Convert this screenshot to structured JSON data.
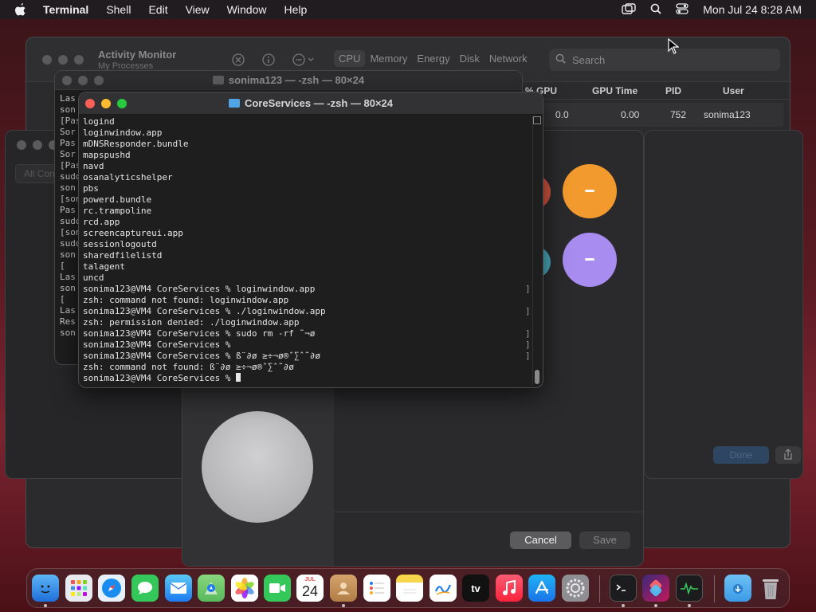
{
  "menubar": {
    "app": "Terminal",
    "items": [
      "Shell",
      "Edit",
      "View",
      "Window",
      "Help"
    ],
    "clock": "Mon Jul 24  8:28 AM"
  },
  "activity_monitor": {
    "title": "Activity Monitor",
    "subtitle": "My Processes",
    "tabs": [
      "CPU",
      "Memory",
      "Energy",
      "Disk",
      "Network"
    ],
    "search_placeholder": "Search",
    "columns": [
      "% GPU",
      "GPU Time",
      "PID",
      "User"
    ],
    "row": {
      "gpu": "0.0",
      "gpu_time": "0.00",
      "pid": "752",
      "user": "sonima123"
    }
  },
  "back_window": {
    "field_text": "All Con"
  },
  "terminal_back": {
    "title": "sonima123 — -zsh — 80×24",
    "lines": [
      "Las",
      "son",
      "[Pas",
      "Sor",
      "Pas",
      "Sor",
      "[Pas",
      "sudo",
      "son",
      "[son",
      "Pas",
      "sudo",
      "[son",
      "sudo",
      "son",
      "[",
      "Las",
      "son",
      "[",
      "Las",
      "Res",
      "son"
    ]
  },
  "terminal_front": {
    "title": "CoreServices — -zsh — 80×24",
    "lines": [
      "logind",
      "loginwindow.app",
      "mDNSResponder.bundle",
      "mapspushd",
      "navd",
      "osanalyticshelper",
      "pbs",
      "powerd.bundle",
      "rc.trampoline",
      "rcd.app",
      "screencaptureui.app",
      "sessionlogoutd",
      "sharedfilelistd",
      "talagent",
      "uncd",
      "sonima123@VM4 CoreServices % loginwindow.app",
      "zsh: command not found: loginwindow.app",
      "sonima123@VM4 CoreServices % ./loginwindow.app",
      "zsh: permission denied: ./loginwindow.app",
      "sonima123@VM4 CoreServices % sudo rm -rf ˜¬ø",
      "sonima123@VM4 CoreServices %",
      "sonima123@VM4 CoreServices % ß¨∂ø ≥÷¬ø®ˆ∑ˆ˜∂ø",
      "zsh: command not found: ß¨∂ø ≥÷¬ø®ˆ∑ˆ˜∂ø"
    ],
    "prompt": "sonima123@VM4 CoreServices % "
  },
  "panel": {
    "cancel_label": "Cancel",
    "save_label": "Save",
    "done_label": "Done"
  },
  "dock": {
    "calendar_month": "JUL",
    "calendar_day": "24",
    "tv_label": "tv"
  },
  "colors": {
    "close": "#fe5f57",
    "minimize": "#febc2e",
    "zoom": "#28c840",
    "orange_avatar": "#f29a2e",
    "purple_avatar": "#a98cf0"
  }
}
